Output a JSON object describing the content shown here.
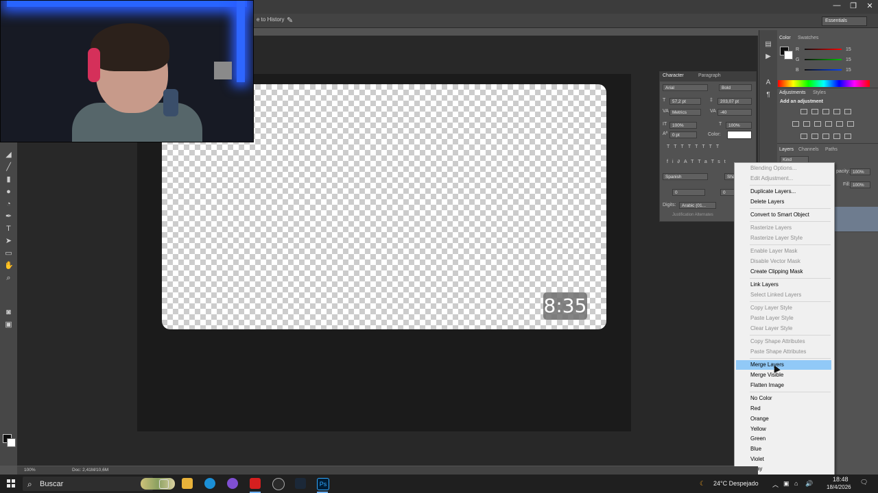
{
  "app": {
    "history_hint": "e to History",
    "workspace": "Essentials",
    "window_controls": [
      "—",
      "❐",
      "✕"
    ]
  },
  "canvas": {
    "duration_badge": "8:35"
  },
  "character_panel": {
    "tabs": [
      "Character",
      "Paragraph"
    ],
    "font_family": "Arial",
    "font_style": "Bold",
    "font_size": "57,2 pt",
    "leading": "203,07 pt",
    "kerning": "Metrics",
    "tracking": "-40",
    "vertical_scale": "100%",
    "horizontal_scale": "100%",
    "baseline_shift": "0 pt",
    "color_label": "Color:",
    "language": "Spanish",
    "antialias": "Sha",
    "para_val1": "0",
    "para_val2": "0",
    "digits_label": "Digits:",
    "digits_value": "Arabic (01...",
    "justification_alternates": "Justification Alternates"
  },
  "color_panel": {
    "tabs": [
      "Color",
      "Swatches"
    ],
    "r_label": "R",
    "g_label": "G",
    "b_label": "B",
    "r": "15",
    "g": "15",
    "b": "15"
  },
  "adjustments_panel": {
    "tabs": [
      "Adjustments",
      "Styles"
    ],
    "title": "Add an adjustment"
  },
  "layers_panel": {
    "tabs": [
      "Layers",
      "Channels",
      "Paths"
    ],
    "kind": "Kind",
    "opacity_label": "pacity:",
    "opacity": "100%",
    "fill_label": "Fill:",
    "fill": "100%"
  },
  "context_menu": {
    "items": [
      {
        "label": "Blending Options...",
        "disabled": true
      },
      {
        "label": "Edit Adjustment...",
        "disabled": true
      },
      {
        "label": "Duplicate Layers...",
        "disabled": false
      },
      {
        "label": "Delete Layers",
        "disabled": false
      },
      {
        "label": "Convert to Smart Object",
        "disabled": false
      },
      {
        "label": "Rasterize Layers",
        "disabled": true
      },
      {
        "label": "Rasterize Layer Style",
        "disabled": true
      },
      {
        "label": "Enable Layer Mask",
        "disabled": true
      },
      {
        "label": "Disable Vector Mask",
        "disabled": true
      },
      {
        "label": "Create Clipping Mask",
        "disabled": false
      },
      {
        "label": "Link Layers",
        "disabled": false
      },
      {
        "label": "Select Linked Layers",
        "disabled": true
      },
      {
        "label": "Copy Layer Style",
        "disabled": true
      },
      {
        "label": "Paste Layer Style",
        "disabled": true
      },
      {
        "label": "Clear Layer Style",
        "disabled": true
      },
      {
        "label": "Copy Shape Attributes",
        "disabled": true
      },
      {
        "label": "Paste Shape Attributes",
        "disabled": true
      },
      {
        "label": "Merge Layers",
        "disabled": false,
        "highlighted": true
      },
      {
        "label": "Merge Visible",
        "disabled": false
      },
      {
        "label": "Flatten Image",
        "disabled": false
      },
      {
        "label": "No Color",
        "disabled": false
      },
      {
        "label": "Red",
        "disabled": false
      },
      {
        "label": "Orange",
        "disabled": false
      },
      {
        "label": "Yellow",
        "disabled": false
      },
      {
        "label": "Green",
        "disabled": false
      },
      {
        "label": "Blue",
        "disabled": false
      },
      {
        "label": "Violet",
        "disabled": false
      },
      {
        "label": "Gray",
        "disabled": false
      }
    ]
  },
  "status_bar": {
    "zoom": "100%",
    "doc_info": "Doc: 2,41M/10,6M"
  },
  "taskbar": {
    "search_placeholder": "Buscar",
    "weather": "24°C  Despejado",
    "time": "18:48",
    "date": "18/4/2026"
  }
}
